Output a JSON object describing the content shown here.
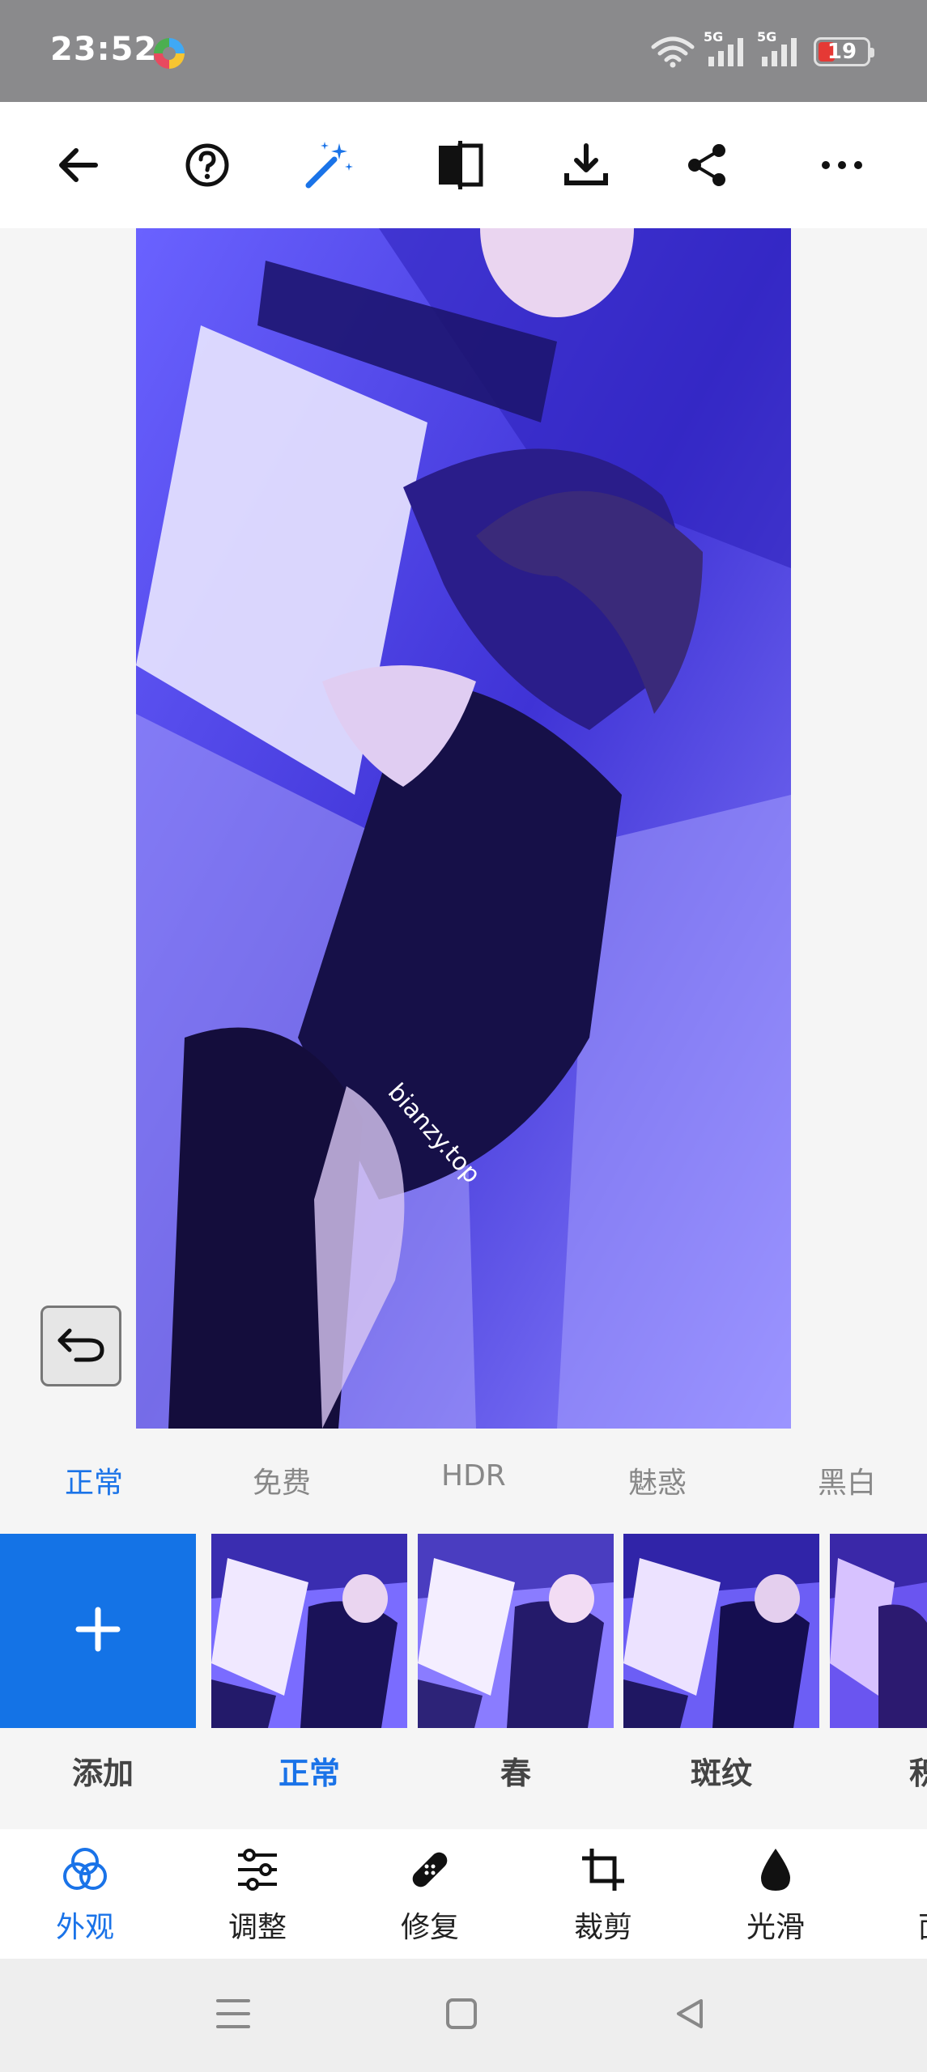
{
  "status_bar": {
    "time": "23:52",
    "network_1": "5G",
    "network_2": "5G",
    "battery_level": "19",
    "battery_color": "#e53935"
  },
  "toolbar": {
    "icons": [
      "back-arrow-icon",
      "help-icon",
      "magic-wand-icon",
      "compare-icon",
      "download-icon",
      "share-icon",
      "more-icon"
    ],
    "accent_color": "#1a73e8"
  },
  "photo": {
    "watermark": "bianzy.top"
  },
  "filter_categories": {
    "items": [
      "正常",
      "免费",
      "HDR",
      "魅惑",
      "黑白"
    ],
    "selected": "正常"
  },
  "filters": {
    "add_label": "添加",
    "items": [
      "正常",
      "春",
      "斑纹",
      "积"
    ],
    "selected": "正常",
    "add_color": "#1473e6"
  },
  "tools": {
    "items": [
      "外观",
      "调整",
      "修复",
      "裁剪",
      "光滑",
      "面"
    ],
    "selected": "外观"
  }
}
